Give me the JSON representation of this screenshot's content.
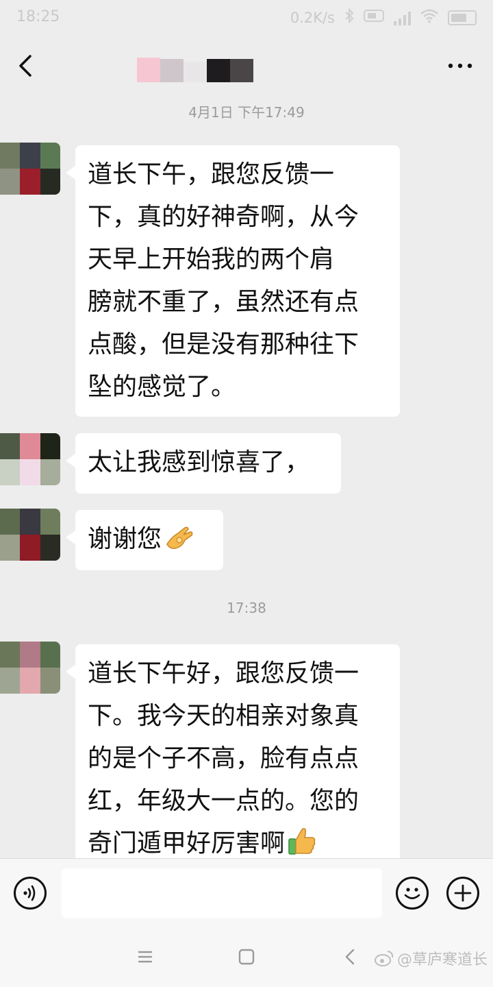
{
  "status_bar": {
    "time": "18:25",
    "network_speed": "0.2K/s"
  },
  "header": {
    "contact_name": ""
  },
  "conversation": {
    "timestamp_1": "4月1日 下午17:49",
    "timestamp_2": "17:38",
    "messages": [
      {
        "lines": [
          "道长下午，跟您反馈一",
          "下，真的好神奇啊，从今",
          "天早上开始我的两个肩",
          "膀就不重了，虽然还有点",
          "点酸，但是没有那种往下",
          "坠的感觉了。"
        ]
      },
      {
        "text": "太让我感到惊喜了，"
      },
      {
        "text": "谢谢您",
        "emoji": "ok-hand-emoji"
      },
      {
        "lines": [
          "道长下午好，跟您反馈一",
          "下。我今天的相亲对象真",
          "的是个子不高，脸有点点",
          "红，年级大一点的。您的",
          "奇门遁甲好厉害啊"
        ],
        "emoji": "thumbs-up-emoji"
      }
    ]
  },
  "input_bar": {
    "placeholder": ""
  },
  "watermark": {
    "text": "@草庐寒道长"
  },
  "colors": {
    "background": "#ededed",
    "bubble": "#ffffff",
    "timestamp": "#9b9b9b"
  }
}
